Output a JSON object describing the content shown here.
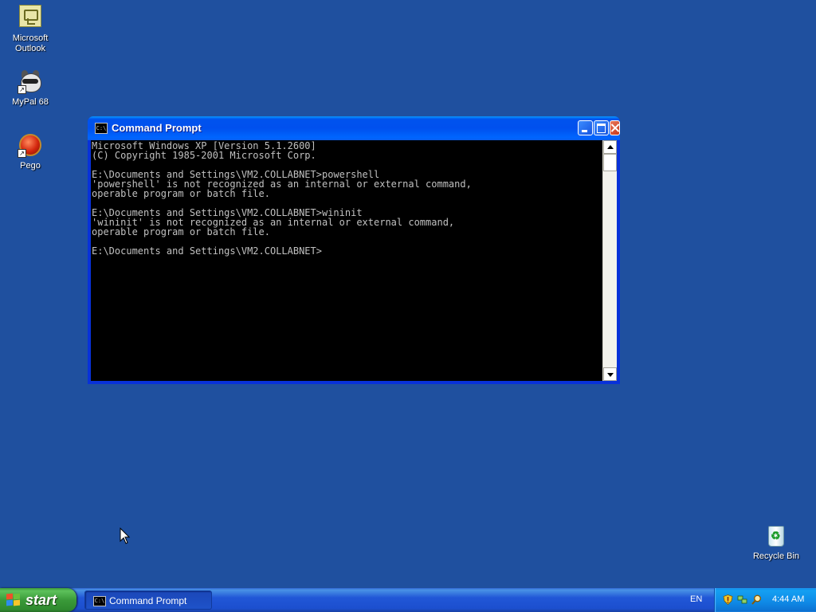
{
  "desktop": {
    "icons": [
      {
        "label_line1": "Microsoft",
        "label_line2": "Outlook"
      },
      {
        "label": "MyPal 68"
      },
      {
        "label": "Pego"
      },
      {
        "label": "Recycle Bin"
      }
    ],
    "background_color": "#1f509f"
  },
  "window": {
    "title": "Command Prompt",
    "icon_glyph": "C:\\",
    "console_text": "Microsoft Windows XP [Version 5.1.2600]\n(C) Copyright 1985-2001 Microsoft Corp.\n\nE:\\Documents and Settings\\VM2.COLLABNET>powershell\n'powershell' is not recognized as an internal or external command,\noperable program or batch file.\n\nE:\\Documents and Settings\\VM2.COLLABNET>wininit\n'wininit' is not recognized as an internal or external command,\noperable program or batch file.\n\nE:\\Documents and Settings\\VM2.COLLABNET>",
    "console_fg": "#c0c0c0",
    "console_bg": "#000000"
  },
  "taskbar": {
    "start_label": "start",
    "task_buttons": [
      {
        "label": "Command Prompt",
        "icon_glyph": "C:\\"
      }
    ],
    "language": "EN",
    "clock": "4:44 AM",
    "tray_icons": [
      "security-shield-icon",
      "network-icon",
      "search-icon"
    ]
  }
}
